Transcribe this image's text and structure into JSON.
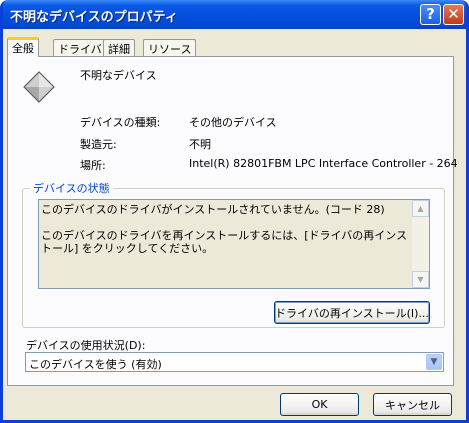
{
  "window": {
    "title": "不明なデバイスのプロパティ"
  },
  "titlebar_buttons": {
    "help": "?",
    "close": "✕"
  },
  "tabs": [
    {
      "label": "全般"
    },
    {
      "label": "ドライバ"
    },
    {
      "label": "詳細"
    },
    {
      "label": "リソース"
    }
  ],
  "device": {
    "name": "不明なデバイス",
    "icon": "unknown-device-icon",
    "props": {
      "type_label": "デバイスの種類:",
      "type_value": "その他のデバイス",
      "mfr_label": "製造元:",
      "mfr_value": "不明",
      "loc_label": "場所:",
      "loc_value": "Intel(R) 82801FBM LPC Interface Controller - 264"
    }
  },
  "status": {
    "group_title": "デバイスの状態",
    "line1": "このデバイスのドライバがインストールされていません。(コード 28)",
    "line2": "このデバイスのドライバを再インストールするには、[ドライバの再インストール] をクリックしてください。"
  },
  "reinstall_button": "ドライバの再インストール(I)...",
  "usage": {
    "label": "デバイスの使用状況(D):",
    "selected": "このデバイスを使う (有効)"
  },
  "buttons": {
    "ok": "OK",
    "cancel": "キャンセル"
  },
  "colors": {
    "title_blue": "#0450e0",
    "dialog_bg": "#ece9d8",
    "active_tab_accent": "#ffc83c",
    "group_title": "#0046d5"
  }
}
